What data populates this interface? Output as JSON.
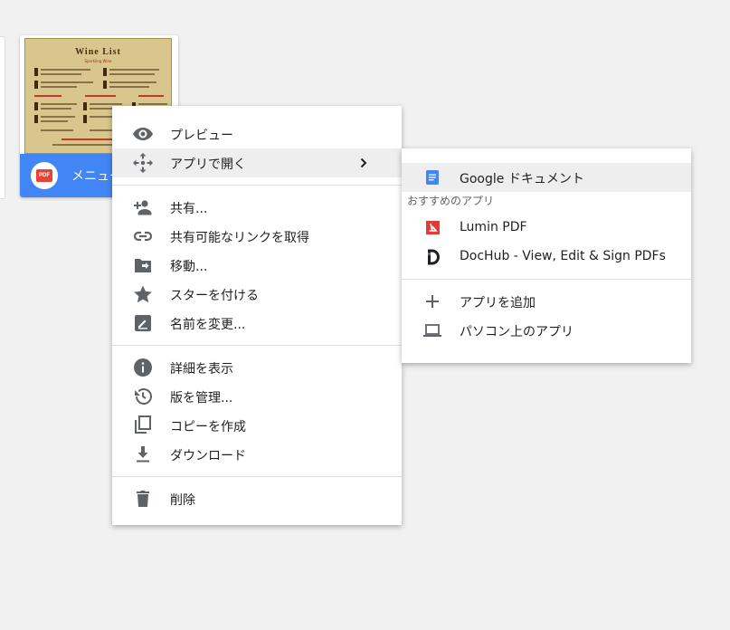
{
  "file": {
    "name": "メニュー",
    "type_badge": "PDF",
    "thumbnail_title": "Wine List",
    "thumbnail_subtitle": "Sparkling Wine"
  },
  "context_menu": {
    "items": [
      {
        "label": "プレビュー",
        "icon": "eye-icon"
      },
      {
        "label": "アプリで開く",
        "icon": "move-arrows-icon",
        "submenu": true
      },
      {
        "label": "共有...",
        "icon": "person-add-icon"
      },
      {
        "label": "共有可能なリンクを取得",
        "icon": "link-icon"
      },
      {
        "label": "移動...",
        "icon": "folder-move-icon"
      },
      {
        "label": "スターを付ける",
        "icon": "star-icon"
      },
      {
        "label": "名前を変更...",
        "icon": "pencil-icon"
      },
      {
        "label": "詳細を表示",
        "icon": "info-icon"
      },
      {
        "label": "版を管理...",
        "icon": "history-icon"
      },
      {
        "label": "コピーを作成",
        "icon": "copy-icon"
      },
      {
        "label": "ダウンロード",
        "icon": "download-icon"
      },
      {
        "label": "削除",
        "icon": "trash-icon"
      }
    ]
  },
  "open_with_menu": {
    "google_docs": "Google ドキュメント",
    "section_label": "おすすめのアプリ",
    "apps": [
      {
        "label": "Lumin PDF",
        "icon": "lumin-pdf-icon"
      },
      {
        "label": "DocHub - View, Edit & Sign PDFs",
        "icon": "dochub-icon"
      }
    ],
    "add_app": "アプリを追加",
    "desktop_apps": "パソコン上のアプリ"
  },
  "colors": {
    "accent": "#4285f4",
    "icon_gray": "#5f6368",
    "pdf_red": "#ea4335",
    "hover": "#eeeeee"
  }
}
